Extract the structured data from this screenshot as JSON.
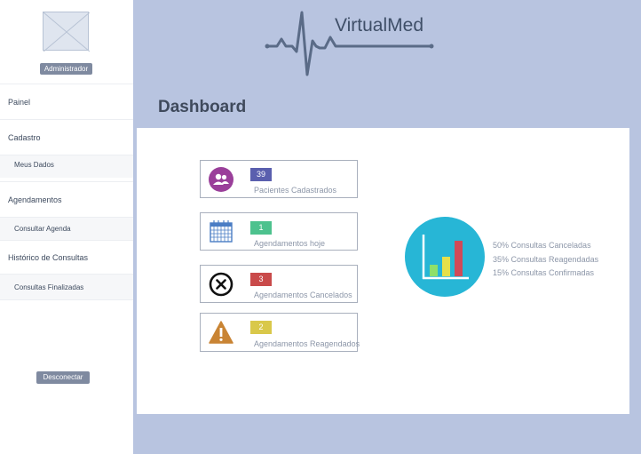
{
  "sidebar": {
    "role_badge": "Administrador",
    "items": [
      {
        "label": "Painel"
      },
      {
        "label": "Cadastro"
      },
      {
        "label": "Meus Dados"
      },
      {
        "label": "Agendamentos"
      },
      {
        "label": "Consultar Agenda"
      },
      {
        "label": "Histórico de Consultas"
      },
      {
        "label": "Consultas Finalizadas"
      }
    ],
    "logout_label": "Desconectar"
  },
  "header": {
    "brand": "VirtualMed",
    "logo_icon": "heartbeat-line-icon"
  },
  "page": {
    "title": "Dashboard"
  },
  "cards": [
    {
      "count": "39",
      "label": "Pacientes Cadastrados",
      "icon": "users-icon",
      "color": "#5a5fae"
    },
    {
      "count": "1",
      "label": "Agendamentos hoje",
      "icon": "calendar-icon",
      "color": "#4dc28e"
    },
    {
      "count": "3",
      "label": "Agendamentos Cancelados",
      "icon": "cancel-circle-icon",
      "color": "#c94a4a"
    },
    {
      "count": "2",
      "label": "Agendamentos Reagendados",
      "icon": "warning-icon",
      "color": "#d9c84a"
    }
  ],
  "summary": {
    "chart_icon": "bar-chart-icon",
    "legend": [
      "50% Consultas Canceladas",
      "35% Consultas Reagendadas",
      "15% Consultas Confirmadas"
    ]
  },
  "colors": {
    "background": "#b8c4e0",
    "accent": "#27b6d6",
    "badge": "#7f8aa0"
  }
}
